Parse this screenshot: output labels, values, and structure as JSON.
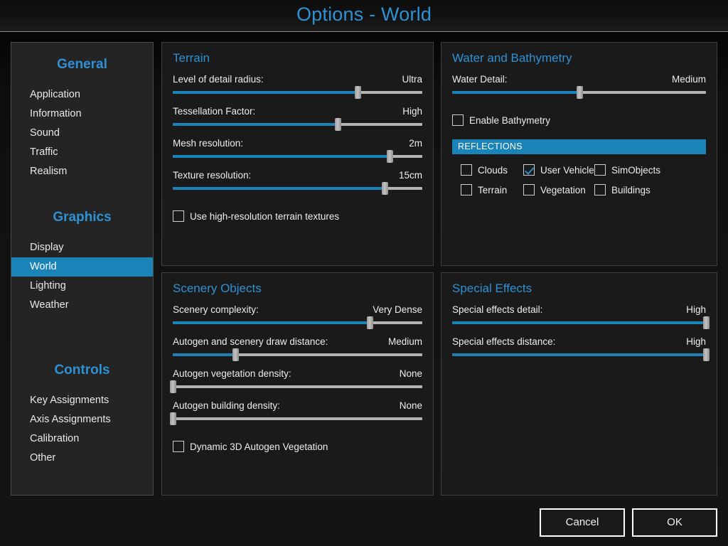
{
  "window": {
    "title": "Options - World",
    "accent_color": "#1a84b8",
    "title_color": "#2e91d4",
    "panel_bg": "#1a1a1a",
    "sidebar_bg": "#242424"
  },
  "sidebar": {
    "groups": [
      {
        "title": "General",
        "items": [
          {
            "label": "Application",
            "active": false
          },
          {
            "label": "Information",
            "active": false
          },
          {
            "label": "Sound",
            "active": false
          },
          {
            "label": "Traffic",
            "active": false
          },
          {
            "label": "Realism",
            "active": false
          }
        ]
      },
      {
        "title": "Graphics",
        "items": [
          {
            "label": "Display",
            "active": false
          },
          {
            "label": "World",
            "active": true
          },
          {
            "label": "Lighting",
            "active": false
          },
          {
            "label": "Weather",
            "active": false
          }
        ]
      },
      {
        "title": "Controls",
        "items": [
          {
            "label": "Key Assignments",
            "active": false
          },
          {
            "label": "Axis Assignments",
            "active": false
          },
          {
            "label": "Calibration",
            "active": false
          },
          {
            "label": "Other",
            "active": false
          }
        ]
      }
    ]
  },
  "panels": {
    "terrain": {
      "title": "Terrain",
      "sliders": [
        {
          "label": "Level of detail radius:",
          "value": "Ultra",
          "percent": 74
        },
        {
          "label": "Tessellation Factor:",
          "value": "High",
          "percent": 66
        },
        {
          "label": "Mesh resolution:",
          "value": "2m",
          "percent": 87
        },
        {
          "label": "Texture resolution:",
          "value": "15cm",
          "percent": 85
        }
      ],
      "checkbox": {
        "label": "Use high-resolution terrain textures",
        "checked": false
      }
    },
    "water": {
      "title": "Water and Bathymetry",
      "sliders": [
        {
          "label": "Water Detail:",
          "value": "Medium",
          "percent": 50
        }
      ],
      "bathymetry_checkbox": {
        "label": "Enable Bathymetry",
        "checked": false
      },
      "reflections_header": "REFLECTIONS",
      "reflections": [
        {
          "label": "Clouds",
          "checked": false
        },
        {
          "label": "User Vehicle",
          "checked": true
        },
        {
          "label": "SimObjects",
          "checked": false
        },
        {
          "label": "Terrain",
          "checked": false
        },
        {
          "label": "Vegetation",
          "checked": false
        },
        {
          "label": "Buildings",
          "checked": false
        }
      ]
    },
    "scenery": {
      "title": "Scenery Objects",
      "sliders": [
        {
          "label": "Scenery complexity:",
          "value": "Very Dense",
          "percent": 79
        },
        {
          "label": "Autogen and scenery draw distance:",
          "value": "Medium",
          "percent": 25
        },
        {
          "label": "Autogen vegetation density:",
          "value": "None",
          "percent": 0
        },
        {
          "label": "Autogen building density:",
          "value": "None",
          "percent": 0
        }
      ],
      "checkbox": {
        "label": "Dynamic 3D Autogen Vegetation",
        "checked": false
      }
    },
    "effects": {
      "title": "Special Effects",
      "sliders": [
        {
          "label": "Special effects detail:",
          "value": "High",
          "percent": 100
        },
        {
          "label": "Special effects distance:",
          "value": "High",
          "percent": 100
        }
      ]
    }
  },
  "footer": {
    "cancel_label": "Cancel",
    "ok_label": "OK"
  }
}
